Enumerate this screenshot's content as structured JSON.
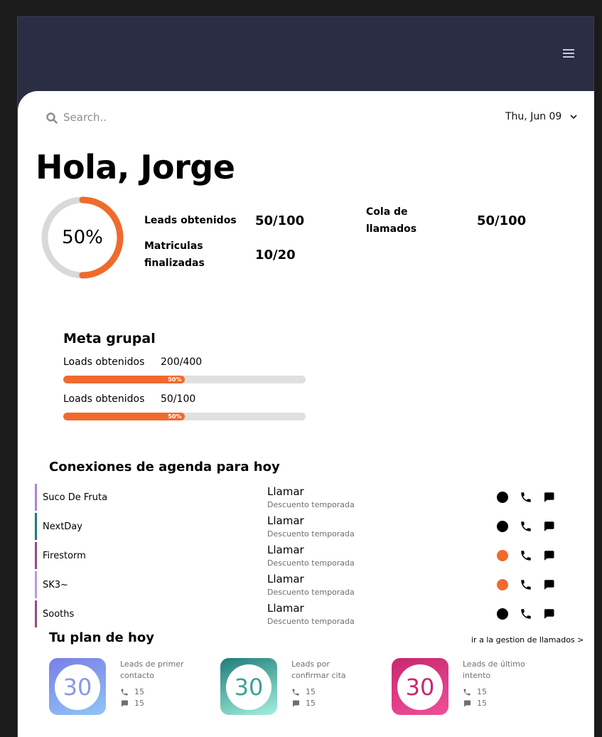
{
  "search": {
    "placeholder": "Search.."
  },
  "date": {
    "selected": "Thu, Jun 09"
  },
  "greeting": "Hola, Jorge",
  "progress": {
    "label": "50%",
    "value": 0.5
  },
  "stats": [
    {
      "label": "Leads obtenidos",
      "value": "50/100"
    },
    {
      "label": "Matriculas finalizadas",
      "value": "10/20"
    },
    {
      "label": "Cola de llamados",
      "value": "50/100"
    }
  ],
  "meta": {
    "title": "Meta grupal",
    "items": [
      {
        "label": "Loads obtenidos",
        "value": "200/400",
        "percent_label": "50%",
        "fraction": 0.5
      },
      {
        "label": "Loads obtenidos",
        "value": "50/100",
        "percent_label": "50%",
        "fraction": 0.5
      }
    ]
  },
  "agenda": {
    "title": "Conexiones de agenda para hoy",
    "rows": [
      {
        "name": "Suco De Fruta",
        "action": "Llamar",
        "sub": "Descuento temporada",
        "accent": "#b27fd6",
        "status": "#000000"
      },
      {
        "name": "NextDay",
        "action": "Llamar",
        "sub": "Descuento temporada",
        "accent": "#1c7a82",
        "status": "#000000"
      },
      {
        "name": "Firestorm",
        "action": "Llamar",
        "sub": "Descuento temporada",
        "accent": "#a0477f",
        "status": "#f06a2d"
      },
      {
        "name": "SK3~",
        "action": "Llamar",
        "sub": "Descuento temporada",
        "accent": "#b99ae0",
        "status": "#f06a2d"
      },
      {
        "name": "Sooths",
        "action": "Llamar",
        "sub": "Descuento temporada",
        "accent": "#a0477f",
        "status": "#000000"
      }
    ]
  },
  "plan": {
    "title": "Tu plan de hoy",
    "link": "ir a la gestion de llamados >",
    "cards": [
      {
        "count": "30",
        "title": "Leads de primer contacto",
        "calls": "15",
        "messages": "15",
        "gradient": [
          "#7b7ee8",
          "#8fc5f6"
        ],
        "number_color": "#8a98e8"
      },
      {
        "count": "30",
        "title": "Leads por confirmar cita",
        "calls": "15",
        "messages": "15",
        "gradient": [
          "#1f7d79",
          "#a6f0df"
        ],
        "number_color": "#3aa296"
      },
      {
        "count": "30",
        "title": "Leads de último intento",
        "calls": "15",
        "messages": "15",
        "gradient": [
          "#c8286e",
          "#f04f98"
        ],
        "number_color": "#c8286e"
      }
    ]
  },
  "colors": {
    "header_bg": "#2a2d44",
    "accent": "#f06a2d"
  }
}
